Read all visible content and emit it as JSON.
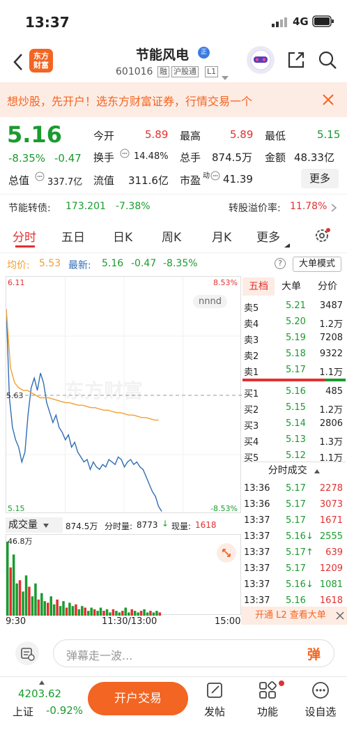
{
  "status": {
    "time": "13:37",
    "network": "4G"
  },
  "header": {
    "title": "节能风电",
    "code": "601016",
    "tags": [
      "融",
      "沪股通",
      "L1"
    ],
    "logo_text": "东方财富",
    "badge": "正"
  },
  "banner": {
    "text": "想炒股，先开户！选东方财富证券，行情交易一个"
  },
  "quote": {
    "price": "5.16",
    "change_pct": "-8.35%",
    "change": "-0.47",
    "labels": {
      "open": "今开",
      "high": "最高",
      "low": "最低",
      "turnover": "换手",
      "volume": "总手",
      "amount": "金额",
      "mktcap": "总值",
      "float": "流值",
      "pe": "市盈",
      "pe_sup": "动",
      "more": "更多"
    },
    "open": "5.89",
    "high": "5.89",
    "low": "5.15",
    "turnover": "14.48%",
    "volume": "874.5万",
    "amount": "48.33亿",
    "mktcap": "337.7亿",
    "float": "311.6亿",
    "pe": "41.39"
  },
  "bond": {
    "label": "节能转债:",
    "price": "173.201",
    "pct": "-7.38%",
    "premium_label": "转股溢价率:",
    "premium": "11.78%"
  },
  "tabs": [
    "分时",
    "五日",
    "日K",
    "周K",
    "月K",
    "更多"
  ],
  "chart_header": {
    "avg_label": "均价:",
    "avg": "5.53",
    "latest_label": "最新:",
    "latest": "5.16",
    "chg": "-0.47",
    "pct": "-8.35%",
    "big_order": "大单模式"
  },
  "chart_axes": {
    "top_left": "6.11",
    "top_right": "8.53%",
    "bottom_left": "5.15",
    "bottom_right": "-8.53%",
    "prev_close": "5.63",
    "tooltip": "nnnd",
    "watermark": "东方财富"
  },
  "volume_bar": {
    "label": "成交量",
    "total": "874.5万",
    "period_label": "分时量:",
    "period": "8773",
    "now_label": "现量:",
    "now": "1618",
    "max": "46.8万"
  },
  "x_axis": [
    "9:30",
    "11:30/13:00",
    "15:00"
  ],
  "depth": {
    "tabs": [
      "五档",
      "大单",
      "分价"
    ],
    "asks": [
      {
        "label": "卖5",
        "price": "5.21",
        "vol": "3487"
      },
      {
        "label": "卖4",
        "price": "5.20",
        "vol": "1.2万"
      },
      {
        "label": "卖3",
        "price": "5.19",
        "vol": "7208"
      },
      {
        "label": "卖2",
        "price": "5.18",
        "vol": "9322"
      },
      {
        "label": "卖1",
        "price": "5.17",
        "vol": "1.1万"
      }
    ],
    "bids": [
      {
        "label": "买1",
        "price": "5.16",
        "vol": "485"
      },
      {
        "label": "买2",
        "price": "5.15",
        "vol": "1.2万"
      },
      {
        "label": "买3",
        "price": "5.14",
        "vol": "2806"
      },
      {
        "label": "买4",
        "price": "5.13",
        "vol": "1.3万"
      },
      {
        "label": "买5",
        "price": "5.12",
        "vol": "1.1万"
      }
    ]
  },
  "trades": {
    "title": "分时成交",
    "rows": [
      {
        "time": "13:36",
        "price": "5.17",
        "vol": "2278",
        "vc": "red"
      },
      {
        "time": "13:36",
        "price": "5.17",
        "vol": "3073",
        "vc": "red"
      },
      {
        "time": "13:37",
        "price": "5.17",
        "vol": "1671",
        "vc": "red"
      },
      {
        "time": "13:37",
        "price": "5.16↓",
        "vol": "2555",
        "vc": "green"
      },
      {
        "time": "13:37",
        "price": "5.17↑",
        "vol": "639",
        "vc": "red"
      },
      {
        "time": "13:37",
        "price": "5.17",
        "vol": "1209",
        "vc": "red"
      },
      {
        "time": "13:37",
        "price": "5.16↓",
        "vol": "1081",
        "vc": "green"
      },
      {
        "time": "13:37",
        "price": "5.16",
        "vol": "1618",
        "vc": "red"
      }
    ],
    "promo": "开通 L2 查看大单"
  },
  "danmaku": {
    "placeholder": "弹幕走一波...",
    "btn": "弹"
  },
  "bottom": {
    "index_value": "4203.62",
    "index_name": "上证",
    "index_pct": "-0.92%",
    "trade_btn": "开户交易",
    "post": "发帖",
    "func": "功能",
    "settings": "设自选"
  },
  "colors": {
    "up": "#e23030",
    "down": "#1a9b2f",
    "accent": "#f26522",
    "avg_line": "#f0a030",
    "price_line": "#2f6db5"
  },
  "chart_data": {
    "type": "line",
    "ylim": [
      5.15,
      6.11
    ],
    "prev_close": 5.63,
    "price": [
      5.98,
      5.62,
      5.5,
      5.45,
      5.42,
      5.36,
      5.4,
      5.55,
      5.66,
      5.7,
      5.65,
      5.72,
      5.68,
      5.6,
      5.56,
      5.52,
      5.55,
      5.5,
      5.48,
      5.45,
      5.47,
      5.42,
      5.44,
      5.4,
      5.38,
      5.36,
      5.37,
      5.33,
      5.36,
      5.34,
      5.33,
      5.35,
      5.34,
      5.37,
      5.36,
      5.35,
      5.38,
      5.37,
      5.34,
      5.36,
      5.37,
      5.35,
      5.36,
      5.34,
      5.33,
      5.3,
      5.27,
      5.24,
      5.22,
      5.18,
      5.16
    ],
    "avg": [
      5.98,
      5.74,
      5.68,
      5.66,
      5.65,
      5.65,
      5.64,
      5.63,
      5.62,
      5.62,
      5.62,
      5.615,
      5.61,
      5.605,
      5.6,
      5.6,
      5.595,
      5.59,
      5.59,
      5.585,
      5.58,
      5.58,
      5.575,
      5.57,
      5.57,
      5.565,
      5.56,
      5.56,
      5.555,
      5.55,
      5.55,
      5.545,
      5.54,
      5.54,
      5.535,
      5.53,
      5.53
    ],
    "volume_max": 46.8,
    "volume": [
      46,
      30,
      38,
      20,
      22,
      15,
      25,
      18,
      12,
      20,
      10,
      14,
      9,
      8,
      12,
      7,
      10,
      6,
      9,
      5,
      8,
      6,
      7,
      4,
      6,
      5,
      3,
      5,
      4,
      3,
      5,
      3,
      4,
      2,
      4,
      3,
      2,
      3,
      5,
      2,
      4,
      3,
      2,
      3,
      4,
      2,
      3,
      2,
      3,
      2
    ]
  }
}
